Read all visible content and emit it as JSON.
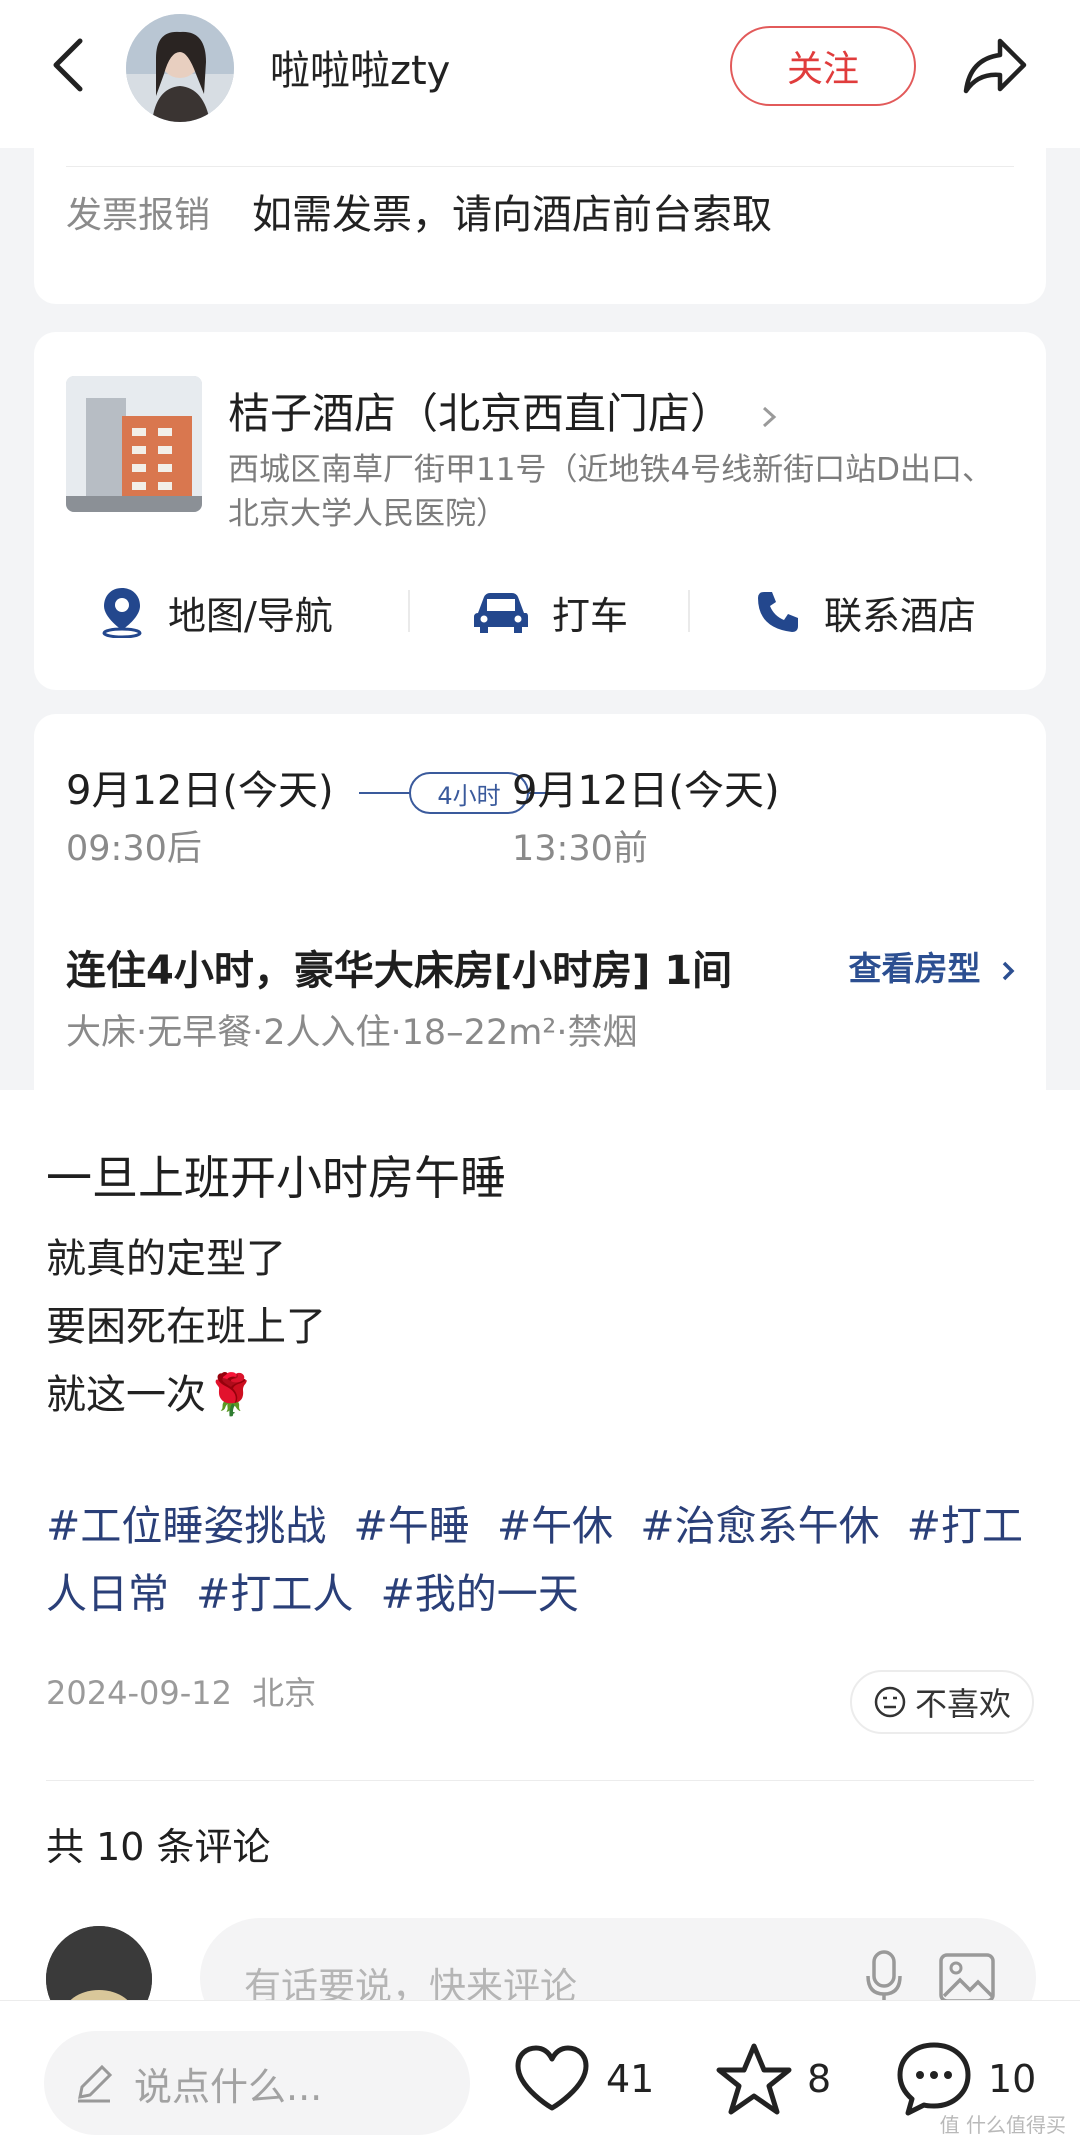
{
  "header": {
    "username": "啦啦啦zty",
    "follow_label": "关注"
  },
  "invoice": {
    "label": "发票报销",
    "text": "如需发票，请向酒店前台索取"
  },
  "hotel": {
    "name": "桔子酒店（北京西直门店）",
    "address": "西城区南草厂街甲11号（近地铁4号线新街口站D出口、北京大学人民医院）",
    "actions": [
      "地图/导航",
      "打车",
      "联系酒店"
    ]
  },
  "booking": {
    "checkin_date": "9月12日(今天)",
    "checkin_time": "09:30后",
    "duration": "4小时",
    "checkout_date": "9月12日(今天)",
    "checkout_time": "13:30前",
    "room_title": "连住4小时，豪华大床房[小时房] 1间",
    "room_link": "查看房型",
    "room_features": "大床·无早餐·2人入住·18–22m²·禁烟"
  },
  "post": {
    "title": "一旦上班开小时房午睡",
    "lines": [
      "就真的定型了",
      "要困死在班上了",
      "就这一次🌹"
    ],
    "tags": [
      "#工位睡姿挑战",
      "#午睡",
      "#午休",
      "#治愈系午休",
      "#打工人日常",
      "#打工人",
      "#我的一天"
    ],
    "date": "2024-09-12",
    "location": "北京",
    "dislike_label": "不喜欢"
  },
  "comments": {
    "count_label": "共 10 条评论",
    "input_placeholder": "有话要说，快来评论"
  },
  "bottom_bar": {
    "say_placeholder": "说点什么...",
    "likes": "41",
    "favorites": "8",
    "comments": "10"
  },
  "watermark": "值 什么值得买",
  "colors": {
    "accent_red": "#e03c3c",
    "brand_blue": "#2c4f91",
    "tag_blue": "#2a3f78"
  }
}
